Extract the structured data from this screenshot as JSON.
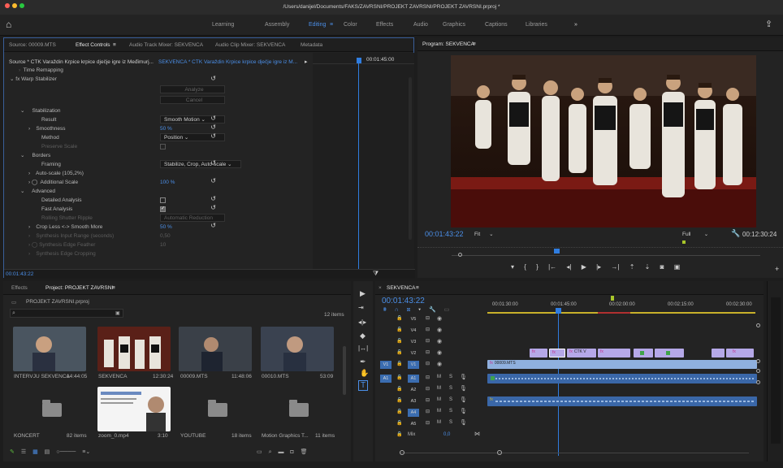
{
  "window": {
    "title": "/Users/danijel/Documents/FAKS/ZAVRSNI/PROJEKT ZAVRSNI/PROJEKT ZAVRSNI.prproj *"
  },
  "workspaces": [
    "Learning",
    "Assembly",
    "Editing",
    "Color",
    "Effects",
    "Audio",
    "Graphics",
    "Captions",
    "Libraries"
  ],
  "workspace_more": "»",
  "source_panel": {
    "tabs": [
      "Source: 00009.MTS",
      "Effect Controls",
      "Audio Track Mixer: SEKVENCA",
      "Audio Clip Mixer: SEKVENCA",
      "Metadata"
    ],
    "menu_icon": "≡",
    "source_label": "Source * CTK Varaždin Krpice krpice dječje igre iz Međimurj...",
    "sequence_label": "SEKVENCA * CTK Varaždin Krpice krpice dječje igre iz M...",
    "timecode_head": "00:01:45:00",
    "timecode_foot": "00:01:43:22",
    "rows": [
      {
        "label": "Time Remapping",
        "indent": 1,
        "kind": "twirl"
      },
      {
        "label": "fx  Warp Stabilizer",
        "indent": 0,
        "kind": "fx"
      },
      {
        "label": "Analyze",
        "kind": "button"
      },
      {
        "label": "Cancel",
        "kind": "button"
      },
      {
        "label": "Stabilization",
        "indent": 2,
        "kind": "group"
      },
      {
        "label": "Result",
        "value": "Smooth Motion",
        "kind": "dropdown"
      },
      {
        "label": "Smoothness",
        "value": "50 %",
        "kind": "blue"
      },
      {
        "label": "Method",
        "value": "Position",
        "kind": "dropdown"
      },
      {
        "label": "Preserve Scale",
        "kind": "checkbox_dim"
      },
      {
        "label": "Borders",
        "indent": 2,
        "kind": "group"
      },
      {
        "label": "Framing",
        "value": "Stabilize, Crop, Auto-scale",
        "kind": "dropdown"
      },
      {
        "label": "Auto-scale (105,2%)",
        "kind": "twirl"
      },
      {
        "label": "Additional Scale",
        "value": "100 %",
        "kind": "blue"
      },
      {
        "label": "Advanced",
        "indent": 2,
        "kind": "group"
      },
      {
        "label": "Detailed Analysis",
        "kind": "checkbox"
      },
      {
        "label": "Fast Analysis",
        "kind": "checkbox_on"
      },
      {
        "label": "Rolling Shutter Ripple",
        "value": "Automatic Reduction",
        "kind": "dim"
      },
      {
        "label": "Crop Less <-> Smooth More",
        "value": "50 %",
        "kind": "blue"
      },
      {
        "label": "Synthesis Input Range (seconds)",
        "value": "0,50",
        "kind": "dim"
      },
      {
        "label": "Synthesis Edge Feather",
        "value": "10",
        "kind": "dim"
      },
      {
        "label": "Synthesis Edge Cropping",
        "kind": "dim"
      }
    ]
  },
  "program": {
    "title": "Program: SEKVENCA",
    "timecode": "00:01:43:22",
    "fit": "Fit",
    "full": "Full",
    "duration": "00:12:30:24"
  },
  "project": {
    "tabs": [
      "Effects",
      "Project: PROJEKT ZAVRSNI"
    ],
    "file": "PROJEKT ZAVRSNI.prproj",
    "count": "12 items",
    "items": [
      {
        "name": "INTERVJU SEKVENCA",
        "meta": "14:44:05",
        "kind": "video"
      },
      {
        "name": "SEKVENCA",
        "meta": "12:30:24",
        "kind": "dance"
      },
      {
        "name": "00009.MTS",
        "meta": "11:48:06",
        "kind": "video"
      },
      {
        "name": "00010.MTS",
        "meta": "53:09",
        "kind": "video"
      },
      {
        "name": "KONCERT",
        "meta": "82 items",
        "kind": "folder"
      },
      {
        "name": "zoom_0.mp4",
        "meta": "3:10",
        "kind": "zoom"
      },
      {
        "name": "YOUTUBE",
        "meta": "18 items",
        "kind": "folder"
      },
      {
        "name": "Motion Graphics T...",
        "meta": "11 items",
        "kind": "folder"
      }
    ]
  },
  "timeline": {
    "title": "SEKVENCA",
    "timecode": "00:01:43:22",
    "ruler": [
      "00:01:30:00",
      "00:01:45:00",
      "00:02:00:00",
      "00:02:15:00",
      "00:02:30:00"
    ],
    "video_tracks": [
      "V5",
      "V4",
      "V3",
      "V2",
      "V1"
    ],
    "audio_tracks": [
      "A1",
      "A2",
      "A3",
      "A4",
      "A5"
    ],
    "mix": "Mix",
    "mix_value": "0,0",
    "clip_v1": "00009.MTS",
    "clip_v2": "CTK V",
    "fx": "fx",
    "M": "M",
    "S": "S"
  },
  "colors": {
    "accent": "#4b8fe8",
    "clip_blue": "#8fb0de",
    "clip_purple": "#b5a8e8",
    "clip_green": "#3fa34a",
    "playhead": "#2f7de0"
  }
}
